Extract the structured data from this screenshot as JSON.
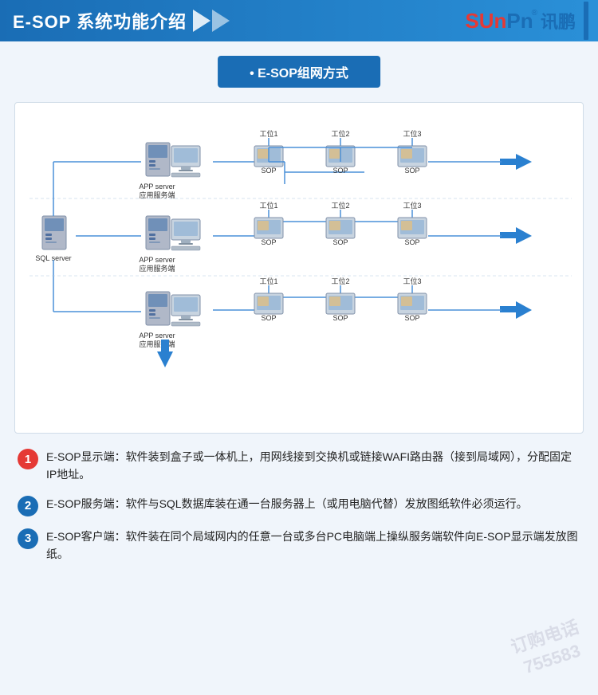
{
  "header": {
    "title": "E-SOP 系统功能介绍",
    "logo": "SUnPn",
    "logo_registered": "®",
    "logo_xunpeng": "讯鹏"
  },
  "diagram_title": "E-SOP组网方式",
  "network_diagram": {
    "sql_server": "SQL server",
    "app_server_label": "APP server",
    "app_server_sub": "应用服务端",
    "workstation_prefix": "工位",
    "sop_label": "SOP",
    "rows": [
      {
        "workstations": [
          "工位1",
          "工位2",
          "工位3"
        ]
      },
      {
        "workstations": [
          "工位1",
          "工位2",
          "工位3"
        ]
      },
      {
        "workstations": [
          "工位1",
          "工位2",
          "工位3"
        ]
      }
    ]
  },
  "info_items": [
    {
      "num": "1",
      "color_class": "info-num-1",
      "text": "E-SOP显示端：软件装到盒子或一体机上，用网线接到交换机或链接WAFI路由器（接到局域网），分配固定IP地址。"
    },
    {
      "num": "2",
      "color_class": "info-num-2",
      "text": "E-SOP服务端：软件与SQL数据库装在通一台服务器上（或用电脑代替）发放图纸软件必须运行。"
    },
    {
      "num": "3",
      "color_class": "info-num-3",
      "text": "E-SOP客户端：软件装在同个局域网内的任意一台或多台PC电脑端上操纵服务端软件向E-SOP显示端发放图纸。"
    }
  ],
  "watermark": {
    "line1": "订购电话",
    "line2": "755583"
  }
}
